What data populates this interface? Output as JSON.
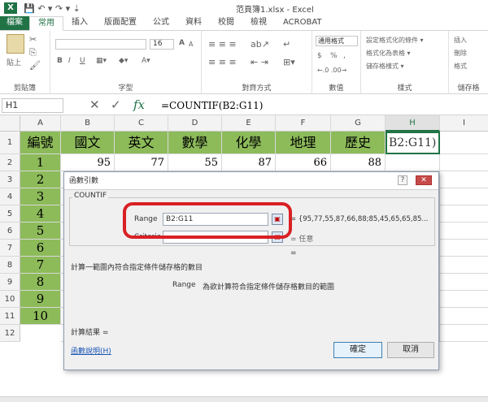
{
  "title_bar": {
    "app_logo": "X",
    "quick_access": "💾  ↶ ▾  ↷ ▾  ⇣",
    "doc_title": "范頁簿1.xlsx - Excel"
  },
  "tabs": [
    "檔案",
    "常用",
    "插入",
    "版面配置",
    "公式",
    "資料",
    "校閱",
    "檢視",
    "ACROBAT"
  ],
  "ribbon": {
    "clipboard": {
      "label": "剪貼簿",
      "paste": "貼上"
    },
    "font": {
      "label": "字型",
      "size": "16",
      "bold": "B",
      "italic": "I",
      "underline": "U",
      "grow": "A",
      "shrink": "A"
    },
    "alignment": {
      "label": "對齊方式"
    },
    "number": {
      "label": "數值",
      "format": "通用格式",
      "currency": "$",
      "percent": "%",
      "comma": ","
    },
    "styles": {
      "label": "樣式",
      "items": [
        "設定格式化的條件 ▾",
        "格式化為表格 ▾",
        "儲存格樣式 ▾"
      ]
    },
    "cells": {
      "label": "儲存格",
      "items": [
        "插入",
        "刪除",
        "格式"
      ]
    }
  },
  "formula_bar": {
    "name_box": "H1",
    "cancel": "✕",
    "enter": "✓",
    "fx": "fx",
    "formula": "=COUNTIF(B2:G11)"
  },
  "columns": [
    "A",
    "B",
    "C",
    "D",
    "E",
    "F",
    "G",
    "H",
    "I"
  ],
  "rows": [
    "1",
    "2",
    "3",
    "4",
    "5",
    "6",
    "7",
    "8",
    "9",
    "10",
    "11",
    "12"
  ],
  "sheet": {
    "headers": [
      "編號",
      "國文",
      "英文",
      "數學",
      "化學",
      "地理",
      "歷史"
    ],
    "ids": [
      "1",
      "2",
      "3",
      "4",
      "5",
      "6",
      "7",
      "8",
      "9",
      "10"
    ],
    "row2": [
      "95",
      "77",
      "55",
      "87",
      "66",
      "88"
    ],
    "h1_text": "B2:G11)"
  },
  "dialog": {
    "title": "函數引數",
    "question": "?",
    "close": "✕",
    "function_name": "COUNTIF",
    "range_label": "Range",
    "range_value": "B2:G11",
    "range_result": "= {95,77,55,87,66,88;85,45,65,65,85...",
    "criteria_label": "Criteria",
    "criteria_result": "= 任意",
    "result_eq": "=",
    "description": "計算一範圍內符合指定條件儲存格的數目",
    "arg_name": "Range",
    "arg_desc": "為欲計算符合指定條件儲存格數目的範圍",
    "calc_result": "計算結果 =",
    "help_link": "函數說明(H)",
    "ok": "確定",
    "cancel": "取消"
  }
}
